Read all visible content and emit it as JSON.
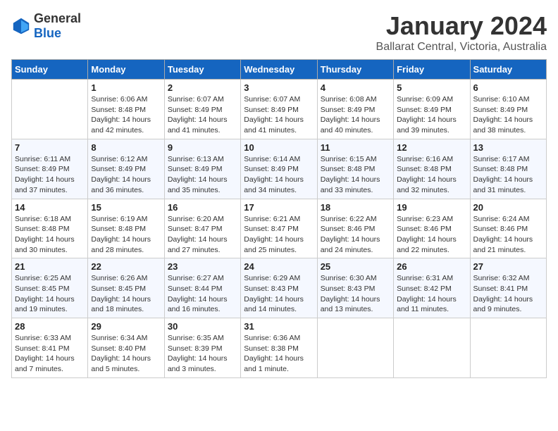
{
  "header": {
    "logo_general": "General",
    "logo_blue": "Blue",
    "main_title": "January 2024",
    "sub_title": "Ballarat Central, Victoria, Australia"
  },
  "calendar": {
    "days_of_week": [
      "Sunday",
      "Monday",
      "Tuesday",
      "Wednesday",
      "Thursday",
      "Friday",
      "Saturday"
    ],
    "weeks": [
      [
        {
          "day": "",
          "info": ""
        },
        {
          "day": "1",
          "info": "Sunrise: 6:06 AM\nSunset: 8:48 PM\nDaylight: 14 hours\nand 42 minutes."
        },
        {
          "day": "2",
          "info": "Sunrise: 6:07 AM\nSunset: 8:49 PM\nDaylight: 14 hours\nand 41 minutes."
        },
        {
          "day": "3",
          "info": "Sunrise: 6:07 AM\nSunset: 8:49 PM\nDaylight: 14 hours\nand 41 minutes."
        },
        {
          "day": "4",
          "info": "Sunrise: 6:08 AM\nSunset: 8:49 PM\nDaylight: 14 hours\nand 40 minutes."
        },
        {
          "day": "5",
          "info": "Sunrise: 6:09 AM\nSunset: 8:49 PM\nDaylight: 14 hours\nand 39 minutes."
        },
        {
          "day": "6",
          "info": "Sunrise: 6:10 AM\nSunset: 8:49 PM\nDaylight: 14 hours\nand 38 minutes."
        }
      ],
      [
        {
          "day": "7",
          "info": "Sunrise: 6:11 AM\nSunset: 8:49 PM\nDaylight: 14 hours\nand 37 minutes."
        },
        {
          "day": "8",
          "info": "Sunrise: 6:12 AM\nSunset: 8:49 PM\nDaylight: 14 hours\nand 36 minutes."
        },
        {
          "day": "9",
          "info": "Sunrise: 6:13 AM\nSunset: 8:49 PM\nDaylight: 14 hours\nand 35 minutes."
        },
        {
          "day": "10",
          "info": "Sunrise: 6:14 AM\nSunset: 8:49 PM\nDaylight: 14 hours\nand 34 minutes."
        },
        {
          "day": "11",
          "info": "Sunrise: 6:15 AM\nSunset: 8:48 PM\nDaylight: 14 hours\nand 33 minutes."
        },
        {
          "day": "12",
          "info": "Sunrise: 6:16 AM\nSunset: 8:48 PM\nDaylight: 14 hours\nand 32 minutes."
        },
        {
          "day": "13",
          "info": "Sunrise: 6:17 AM\nSunset: 8:48 PM\nDaylight: 14 hours\nand 31 minutes."
        }
      ],
      [
        {
          "day": "14",
          "info": "Sunrise: 6:18 AM\nSunset: 8:48 PM\nDaylight: 14 hours\nand 30 minutes."
        },
        {
          "day": "15",
          "info": "Sunrise: 6:19 AM\nSunset: 8:48 PM\nDaylight: 14 hours\nand 28 minutes."
        },
        {
          "day": "16",
          "info": "Sunrise: 6:20 AM\nSunset: 8:47 PM\nDaylight: 14 hours\nand 27 minutes."
        },
        {
          "day": "17",
          "info": "Sunrise: 6:21 AM\nSunset: 8:47 PM\nDaylight: 14 hours\nand 25 minutes."
        },
        {
          "day": "18",
          "info": "Sunrise: 6:22 AM\nSunset: 8:46 PM\nDaylight: 14 hours\nand 24 minutes."
        },
        {
          "day": "19",
          "info": "Sunrise: 6:23 AM\nSunset: 8:46 PM\nDaylight: 14 hours\nand 22 minutes."
        },
        {
          "day": "20",
          "info": "Sunrise: 6:24 AM\nSunset: 8:46 PM\nDaylight: 14 hours\nand 21 minutes."
        }
      ],
      [
        {
          "day": "21",
          "info": "Sunrise: 6:25 AM\nSunset: 8:45 PM\nDaylight: 14 hours\nand 19 minutes."
        },
        {
          "day": "22",
          "info": "Sunrise: 6:26 AM\nSunset: 8:45 PM\nDaylight: 14 hours\nand 18 minutes."
        },
        {
          "day": "23",
          "info": "Sunrise: 6:27 AM\nSunset: 8:44 PM\nDaylight: 14 hours\nand 16 minutes."
        },
        {
          "day": "24",
          "info": "Sunrise: 6:29 AM\nSunset: 8:43 PM\nDaylight: 14 hours\nand 14 minutes."
        },
        {
          "day": "25",
          "info": "Sunrise: 6:30 AM\nSunset: 8:43 PM\nDaylight: 14 hours\nand 13 minutes."
        },
        {
          "day": "26",
          "info": "Sunrise: 6:31 AM\nSunset: 8:42 PM\nDaylight: 14 hours\nand 11 minutes."
        },
        {
          "day": "27",
          "info": "Sunrise: 6:32 AM\nSunset: 8:41 PM\nDaylight: 14 hours\nand 9 minutes."
        }
      ],
      [
        {
          "day": "28",
          "info": "Sunrise: 6:33 AM\nSunset: 8:41 PM\nDaylight: 14 hours\nand 7 minutes."
        },
        {
          "day": "29",
          "info": "Sunrise: 6:34 AM\nSunset: 8:40 PM\nDaylight: 14 hours\nand 5 minutes."
        },
        {
          "day": "30",
          "info": "Sunrise: 6:35 AM\nSunset: 8:39 PM\nDaylight: 14 hours\nand 3 minutes."
        },
        {
          "day": "31",
          "info": "Sunrise: 6:36 AM\nSunset: 8:38 PM\nDaylight: 14 hours\nand 1 minute."
        },
        {
          "day": "",
          "info": ""
        },
        {
          "day": "",
          "info": ""
        },
        {
          "day": "",
          "info": ""
        }
      ]
    ]
  }
}
